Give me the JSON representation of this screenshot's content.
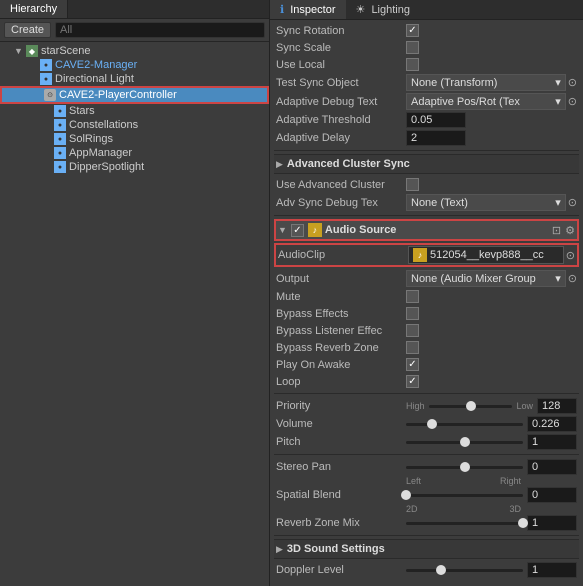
{
  "hierarchy": {
    "tab_label": "Hierarchy",
    "create_label": "Create",
    "search_placeholder": "All",
    "items": [
      {
        "id": "starScene",
        "label": "starScene",
        "level": 0,
        "has_arrow": true,
        "arrow_open": true,
        "icon": "scene",
        "selected": false
      },
      {
        "id": "cave2-manager",
        "label": "CAVE2-Manager",
        "level": 1,
        "has_arrow": false,
        "icon": "game-object",
        "selected": false,
        "color": "blue"
      },
      {
        "id": "directional-light",
        "label": "Directional Light",
        "level": 1,
        "has_arrow": false,
        "icon": "game-object",
        "selected": false,
        "color": "normal"
      },
      {
        "id": "cave2-player",
        "label": "CAVE2-PlayerController",
        "level": 1,
        "has_arrow": false,
        "icon": "game-object",
        "selected": true,
        "color": "white"
      },
      {
        "id": "stars",
        "label": "Stars",
        "level": 2,
        "has_arrow": false,
        "icon": "game-object",
        "selected": false
      },
      {
        "id": "constellations",
        "label": "Constellations",
        "level": 2,
        "has_arrow": false,
        "icon": "game-object",
        "selected": false
      },
      {
        "id": "solrings",
        "label": "SolRings",
        "level": 2,
        "has_arrow": false,
        "icon": "game-object",
        "selected": false
      },
      {
        "id": "appmanager",
        "label": "AppManager",
        "level": 2,
        "has_arrow": false,
        "icon": "game-object",
        "selected": false
      },
      {
        "id": "dipperspotlight",
        "label": "DipperSpotlight",
        "level": 2,
        "has_arrow": false,
        "icon": "game-object",
        "selected": false
      }
    ]
  },
  "inspector": {
    "tab_label": "Inspector",
    "lighting_tab_label": "Lighting",
    "properties": [
      {
        "id": "sync-rotation",
        "label": "Sync Rotation",
        "type": "checkbox",
        "checked": true
      },
      {
        "id": "sync-scale",
        "label": "Sync Scale",
        "type": "checkbox",
        "checked": false
      },
      {
        "id": "use-local",
        "label": "Use Local",
        "type": "checkbox",
        "checked": false
      },
      {
        "id": "test-sync-object",
        "label": "Test Sync Object",
        "type": "dropdown",
        "value": "None (Transform)"
      },
      {
        "id": "adaptive-debug-text",
        "label": "Adaptive Debug Text",
        "type": "dropdown",
        "value": "Adaptive Pos/Rot (Tex"
      },
      {
        "id": "adaptive-threshold",
        "label": "Adaptive Threshold",
        "type": "text",
        "value": "0.05"
      },
      {
        "id": "adaptive-delay",
        "label": "Adaptive Delay",
        "type": "text",
        "value": "2"
      }
    ],
    "advanced_cluster_sync": {
      "section_label": "Advanced Cluster Sync",
      "use_advanced_cluster_label": "Use Advanced Cluster",
      "use_advanced_cluster_checked": false,
      "adv_sync_debug_label": "Adv Sync Debug Tex",
      "adv_sync_debug_value": "None (Text)"
    },
    "audio_source": {
      "section_label": "Audio Source",
      "audio_clip_label": "AudioClip",
      "audio_clip_value": "512054__kevp888__cc",
      "output_label": "Output",
      "output_value": "None (Audio Mixer Group",
      "mute_label": "Mute",
      "mute_checked": false,
      "bypass_effects_label": "Bypass Effects",
      "bypass_effects_checked": false,
      "bypass_listener_label": "Bypass Listener Effec",
      "bypass_listener_checked": false,
      "bypass_reverb_label": "Bypass Reverb Zone",
      "bypass_reverb_checked": false,
      "play_on_awake_label": "Play On Awake",
      "play_on_awake_checked": true,
      "loop_label": "Loop",
      "loop_checked": true,
      "priority_label": "Priority",
      "priority_value": "128",
      "priority_high": "High",
      "priority_low": "Low",
      "priority_percent": 50,
      "volume_label": "Volume",
      "volume_value": "0.226",
      "volume_percent": 22.6,
      "pitch_label": "Pitch",
      "pitch_value": "1",
      "pitch_percent": 50,
      "stereo_pan_label": "Stereo Pan",
      "stereo_pan_value": "0",
      "stereo_pan_left": "Left",
      "stereo_pan_right": "Right",
      "stereo_pan_percent": 50,
      "spatial_blend_label": "Spatial Blend",
      "spatial_blend_value": "0",
      "spatial_blend_2d": "2D",
      "spatial_blend_3d": "3D",
      "spatial_blend_percent": 0,
      "reverb_zone_label": "Reverb Zone Mix",
      "reverb_zone_value": "1",
      "reverb_zone_percent": 100
    },
    "sound_settings": {
      "section_label": "3D Sound Settings",
      "doppler_label": "Doppler Level",
      "doppler_value": "1"
    }
  }
}
